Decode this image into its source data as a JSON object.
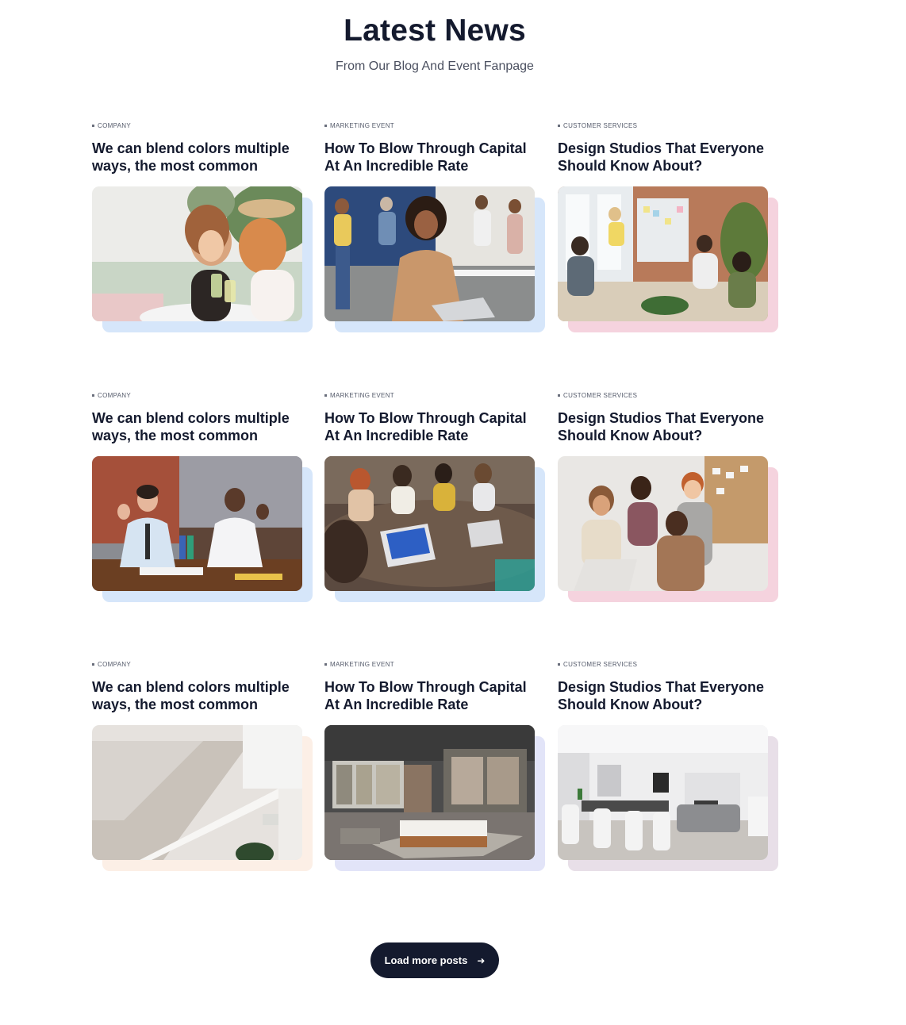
{
  "section": {
    "title": "Latest News",
    "subtitle": "From Our Blog And Event Fanpage"
  },
  "posts": [
    {
      "category": "COMPANY",
      "title": "We can blend colors multiple ways, the most common",
      "image": "two-women-laughing-photo",
      "accent": "#d6e6fa"
    },
    {
      "category": "MARKETING EVENT",
      "title": "How To Blow Through Capital At An Incredible Rate",
      "image": "woman-at-laptop-office-photo",
      "accent": "#d6e6fa"
    },
    {
      "category": "CUSTOMER SERVICES",
      "title": "Design Studios That Everyone Should Know About?",
      "image": "whiteboard-meeting-photo",
      "accent": "#f5d3de"
    },
    {
      "category": "COMPANY",
      "title": "We can blend colors multiple ways, the most common",
      "image": "two-men-celebrating-photo",
      "accent": "#d6e6fa"
    },
    {
      "category": "MARKETING EVENT",
      "title": "How To Blow Through Capital At An Incredible Rate",
      "image": "team-laptops-table-photo",
      "accent": "#d6e6fa"
    },
    {
      "category": "CUSTOMER SERVICES",
      "title": "Design Studios That Everyone Should Know About?",
      "image": "team-around-laptop-photo",
      "accent": "#f5d3de"
    },
    {
      "category": "COMPANY",
      "title": "We can blend colors multiple ways, the most common",
      "image": "white-staircase-photo",
      "accent": "#fcefe6"
    },
    {
      "category": "MARKETING EVENT",
      "title": "How To Blow Through Capital At An Incredible Rate",
      "image": "modern-bedroom-photo",
      "accent": "#e2e4f8"
    },
    {
      "category": "CUSTOMER SERVICES",
      "title": "Design Studios That Everyone Should Know About?",
      "image": "dining-living-room-photo",
      "accent": "#e8dfe8"
    }
  ],
  "load_more": {
    "label": "Load more posts",
    "icon": "arrow-right-icon"
  }
}
